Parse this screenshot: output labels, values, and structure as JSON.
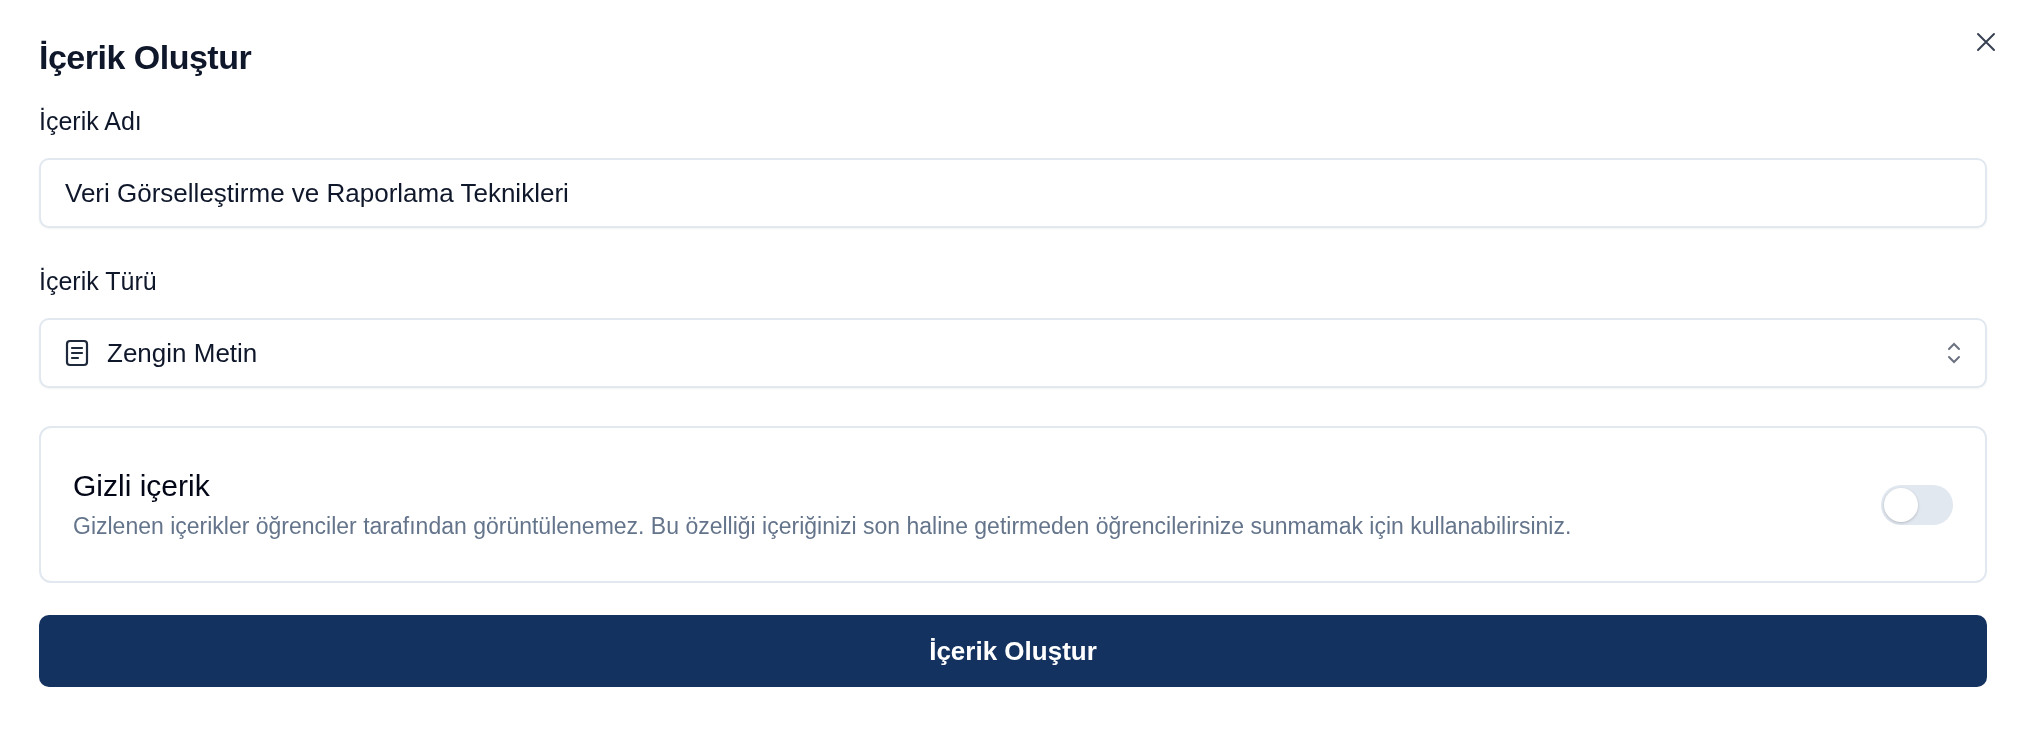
{
  "dialog": {
    "title": "İçerik Oluştur"
  },
  "fields": [
    {
      "kind": "text",
      "label": "İçerik Adı",
      "value": "Veri Görselleştirme ve Raporlama Teknikleri"
    },
    {
      "kind": "select",
      "label": "İçerik Türü",
      "value": "Zengin Metin"
    }
  ],
  "hidden_setting": {
    "title": "Gizli içerik",
    "description": "Gizlenen içerikler öğrenciler tarafından görüntülenemez. Bu özelliği içeriğinizi son haline getirmeden öğrencilerinize sunmamak için kullanabilirsiniz.",
    "on": false
  },
  "submit_button": {
    "label": "İçerik Oluştur"
  }
}
